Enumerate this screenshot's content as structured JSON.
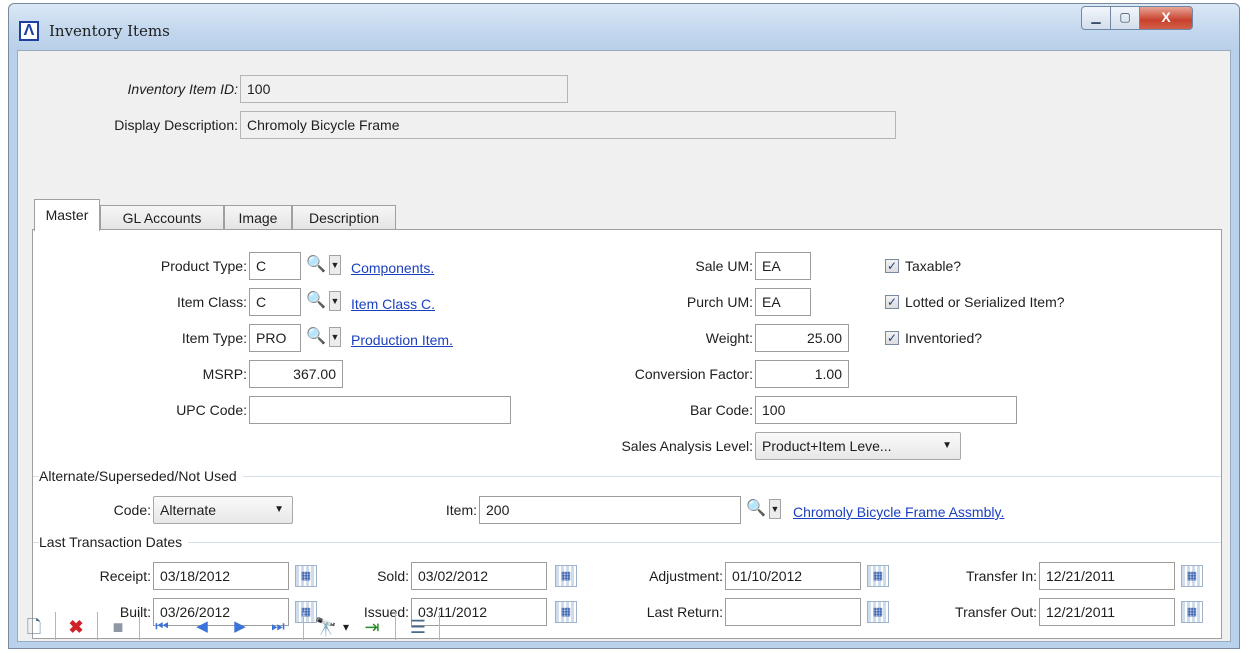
{
  "window": {
    "title": "Inventory Items",
    "logo": "Λ",
    "min_label": "▁",
    "max_label": "▢",
    "close_label": "X"
  },
  "header": {
    "item_id_label": "Inventory Item ID:",
    "item_id": "100",
    "desc_label": "Display Description:",
    "desc": "Chromoly Bicycle Frame"
  },
  "tabs": [
    "Master",
    "GL Accounts",
    "Image",
    "Description"
  ],
  "master": {
    "product_type": {
      "label": "Product Type:",
      "value": "C",
      "link": "Components."
    },
    "item_class": {
      "label": "Item Class:",
      "value": "C",
      "link": "Item Class C."
    },
    "item_type": {
      "label": "Item Type:",
      "value": "PRO",
      "link": "Production Item."
    },
    "msrp": {
      "label": "MSRP:",
      "value": "367.00"
    },
    "upc": {
      "label": "UPC Code:",
      "value": ""
    },
    "sale_um": {
      "label": "Sale UM:",
      "value": "EA"
    },
    "purch_um": {
      "label": "Purch UM:",
      "value": "EA"
    },
    "weight": {
      "label": "Weight:",
      "value": "25.00"
    },
    "conversion": {
      "label": "Conversion Factor:",
      "value": "1.00"
    },
    "bar_code": {
      "label": "Bar Code:",
      "value": "100"
    },
    "sales_level": {
      "label": "Sales Analysis Level:",
      "value": "Product+Item Leve..."
    },
    "checks": [
      {
        "label": "Taxable?",
        "checked": true
      },
      {
        "label": "Lotted or Serialized Item?",
        "checked": true
      },
      {
        "label": "Inventoried?",
        "checked": true
      }
    ],
    "check_mark": "✓"
  },
  "alternate": {
    "header": "Alternate/Superseded/Not Used",
    "code_label": "Code:",
    "code": "Alternate",
    "item_label": "Item:",
    "item": "200",
    "item_link": "Chromoly Bicycle Frame Assmbly."
  },
  "dates": {
    "header": "Last Transaction Dates",
    "receipt": {
      "label": "Receipt:",
      "value": "03/18/2012"
    },
    "built": {
      "label": "Built:",
      "value": "03/26/2012"
    },
    "sold": {
      "label": "Sold:",
      "value": "03/02/2012"
    },
    "issued": {
      "label": "Issued:",
      "value": "03/11/2012"
    },
    "adjustment": {
      "label": "Adjustment:",
      "value": "01/10/2012"
    },
    "last_return": {
      "label": "Last Return:",
      "value": ""
    },
    "transfer_in": {
      "label": "Transfer In:",
      "value": "12/21/2011"
    },
    "transfer_out": {
      "label": "Transfer Out:",
      "value": "12/21/2011"
    }
  },
  "icons": {
    "lookup": "🔍",
    "dropdown": "▼",
    "calendar": "▦",
    "new": "🗋",
    "delete": "✖",
    "save": "■",
    "first": "⏮",
    "prev": "◀",
    "next": "▶",
    "last": "⏭",
    "find": "🔭",
    "find_arrow": "▾",
    "export": "⇥",
    "list": "☰"
  },
  "colors": {
    "link": "#1b3fc1",
    "delete": "#d0202a",
    "nav": "#3a74d8"
  }
}
